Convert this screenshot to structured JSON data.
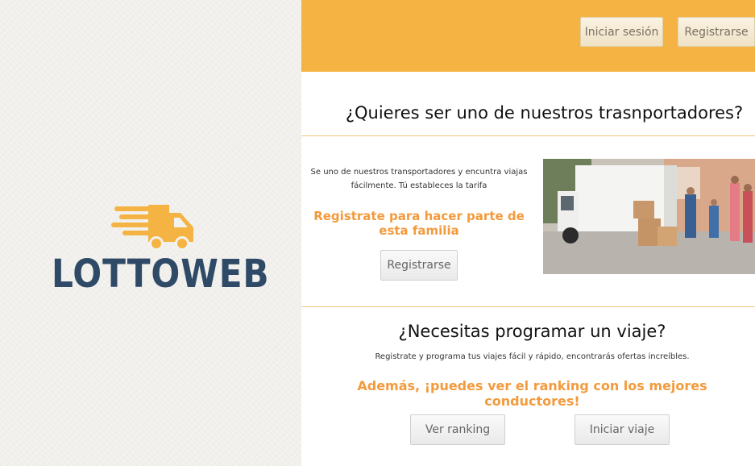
{
  "brand": {
    "name": "LOTTOWEB",
    "primary_color": "#2f4a66",
    "accent_color": "#f4b342"
  },
  "header": {
    "login_label": "Iniciar sesión",
    "signup_label": "Registrarse"
  },
  "carrier_section": {
    "title": "¿Quieres ser uno de nuestros trasnportadores?",
    "description": "Se uno de nuestros transportadores y encuntra viajas fácilmente. Tú estableces la tarifa",
    "cta_text": "Registrate para hacer parte de esta familia",
    "button_label": "Registrarse"
  },
  "trip_section": {
    "title": "¿Necesitas programar un viaje?",
    "description": "Registrate y programa tus viajes fácil y rápido, encontrarás ofertas increíbles.",
    "highlight": "Además, ¡puedes ver el ranking con los mejores conductores!",
    "ranking_button": "Ver ranking",
    "start_button": "Iniciar viaje"
  }
}
